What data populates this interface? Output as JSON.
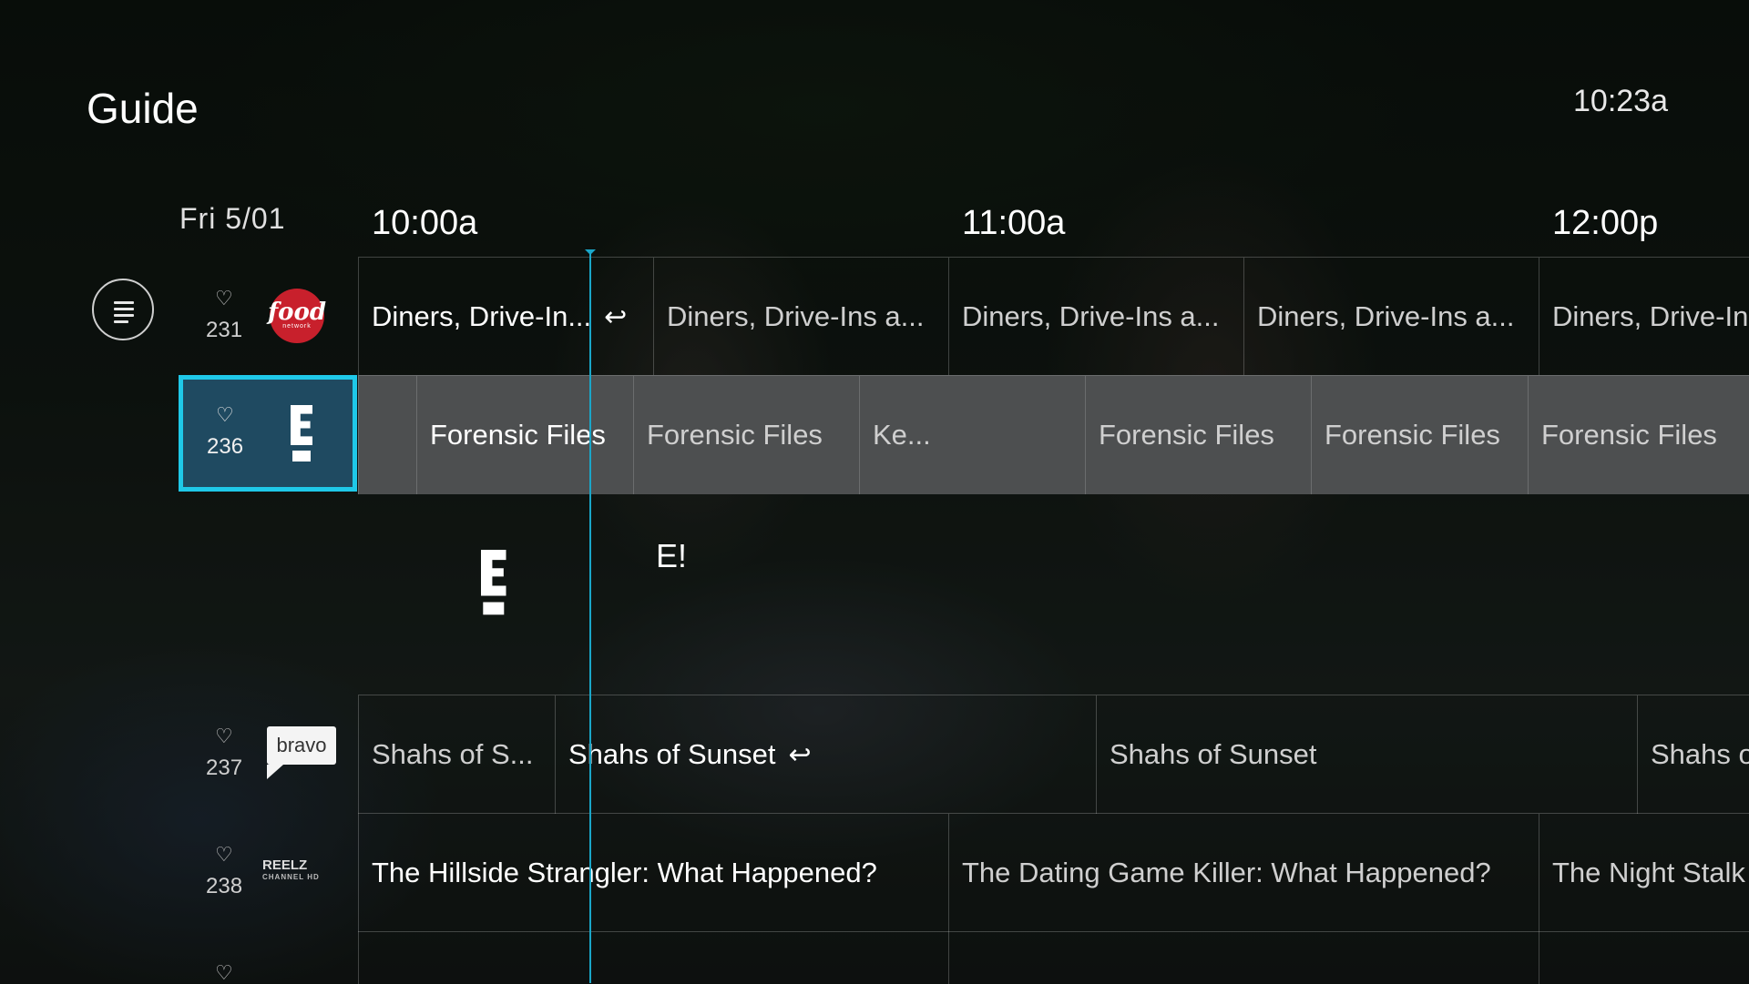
{
  "header": {
    "title": "Guide",
    "clock": "10:23a"
  },
  "timeline": {
    "date": "Fri 5/01",
    "slots": [
      "10:00a",
      "11:00a",
      "12:00p"
    ]
  },
  "colors": {
    "accent": "#1fc8e8",
    "now_line": "#1aa6c8",
    "selected_row": "#4d4f50",
    "selected_channel": "#1f4a61"
  },
  "menu_icon": "menu-lines-icon",
  "channels": [
    {
      "number": "231",
      "logo": "food",
      "logo_sub": "network",
      "programs": [
        {
          "title": "Diners, Drive-In...",
          "restart": "↩"
        },
        {
          "title": "Diners, Drive-Ins a..."
        },
        {
          "title": "Diners, Drive-Ins a..."
        },
        {
          "title": "Diners, Drive-Ins a..."
        },
        {
          "title": "Diners, Drive-In"
        }
      ]
    },
    {
      "number": "236",
      "logo": "E!",
      "selected": true,
      "programs": [
        {
          "title": ""
        },
        {
          "title": "Forensic Files"
        },
        {
          "title": "Forensic Files"
        },
        {
          "title": "Ke..."
        },
        {
          "title": "Forensic Files"
        },
        {
          "title": "Forensic Files"
        },
        {
          "title": "Forensic Files"
        }
      ]
    },
    {
      "number": "237",
      "logo": "bravo",
      "programs": [
        {
          "title": "Shahs of S..."
        },
        {
          "title": "Shahs of Sunset",
          "restart": "↩"
        },
        {
          "title": "Shahs of Sunset"
        },
        {
          "title": "Shahs o"
        }
      ]
    },
    {
      "number": "238",
      "logo": "REELZ",
      "logo_sub": "CHANNEL HD",
      "programs": [
        {
          "title": "The Hillside Strangler: What Happened?"
        },
        {
          "title": "The Dating Game Killer: What Happened?"
        },
        {
          "title": "The Night Stalk"
        }
      ]
    }
  ],
  "preview": {
    "channel_name": "E!"
  }
}
